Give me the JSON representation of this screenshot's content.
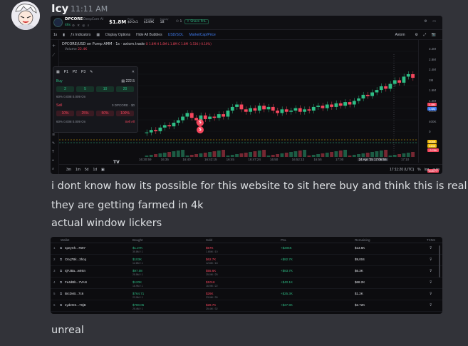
{
  "message": {
    "username": "Icy",
    "timestamp": "11:11 AM",
    "lines": [
      "i dont know how its possible for this website to sit here buy and think this is real",
      "they are getting farmed in 4k",
      "actual window lickers"
    ],
    "followup": "unreal"
  },
  "colors": {
    "background": "#323339",
    "candle_up": "#2ebd85",
    "candle_down": "#f6465d",
    "accent": "#3f7cf0"
  },
  "token": {
    "ticker": "DPCORE",
    "name": "DeepCore AI",
    "age": "46s",
    "market_cap": "$1.8M",
    "stats": [
      {
        "label": "Price",
        "value": "$0.0₃1"
      },
      {
        "label": "Liquidity",
        "value": "$149K"
      },
      {
        "label": "Supply",
        "value": "1B"
      }
    ],
    "holders": "1",
    "share_label": "Share PnL"
  },
  "toolbar": {
    "interval": "1s",
    "indicators": "Indicators",
    "display_options": "Display Options",
    "hide_bubbles": "Hide All Bubbles",
    "pair_toggle": "USD/SOL",
    "mcap_toggle": "MarketCap/Price",
    "right_label": "Axiom"
  },
  "chart": {
    "title": "DPCORE/USD on Pump AMM · 1s · axiom.trade",
    "ohlc": "O 1.8M  H 1.8M  L 1.8M  C 1.8M  -1.53K (-0.10%)",
    "volume_label": "Volume",
    "volume_value": "22.4K",
    "price_ticks": [
      "3.2M",
      "2.8M",
      "2.4M",
      "2M",
      "1.6M",
      "1.2M",
      "800K",
      "400K",
      "0",
      "-400K"
    ],
    "price_tags": [
      {
        "value": "1.8M",
        "color": "#f6465d"
      },
      {
        "value": "1.6M",
        "color": "#3f7cf0"
      },
      {
        "value": "306K",
        "color": "#f0b90b"
      },
      {
        "value": "348K",
        "color": "#f0b90b"
      },
      {
        "value": "-3.25K",
        "color": "#f6465d"
      },
      {
        "value": "308.77",
        "color": "#f6465d"
      }
    ],
    "time_ticks": [
      "16:30:59",
      "16:35",
      "16:40",
      "16:42:15",
      "16:45",
      "16:47:24",
      "16:50",
      "16:52:13",
      "16:55",
      "17:00",
      "24 Apr '25  17:06:56",
      "17:05",
      "17:10"
    ],
    "ranges": [
      "3m",
      "1m",
      "5d",
      "1d"
    ],
    "clock": "17:11:20 (UTC)",
    "scale_options": [
      "%",
      "log",
      "auto"
    ],
    "bubbles": [
      "S",
      "S"
    ],
    "candles": [
      0.12,
      0.14,
      0.13,
      0.16,
      0.18,
      0.17,
      0.2,
      0.22,
      0.25,
      0.28,
      0.24,
      0.22,
      0.26,
      0.23,
      0.25,
      0.24,
      0.27,
      0.25,
      0.3,
      0.33,
      0.35,
      0.31,
      0.29,
      0.32,
      0.3,
      0.34,
      0.31,
      0.33,
      0.3,
      0.28,
      0.31,
      0.29,
      0.3,
      0.32,
      0.29,
      0.31,
      0.3,
      0.33,
      0.34,
      0.32,
      0.35,
      0.33,
      0.36,
      0.34,
      0.37,
      0.35,
      0.38,
      0.4,
      0.43,
      0.42,
      0.45,
      0.47,
      0.5,
      0.48,
      0.52,
      0.55,
      0.53,
      0.58,
      0.6,
      0.57
    ]
  },
  "trade_panel": {
    "presets": [
      "P1",
      "P2",
      "P3"
    ],
    "buy_label": "Buy",
    "balance": "222.5",
    "buy_amounts": [
      "2",
      "5",
      "10",
      "20"
    ],
    "sell_label": "Sell",
    "sell_amounts": [
      "10%",
      "25%",
      "50%",
      "100%"
    ],
    "position": "0 DPCORE · $0",
    "row_buy": "60%   0.008   0.009   On",
    "row_sell": "60%   0.008   0.009   On",
    "sell_all": "Sell All"
  },
  "table": {
    "headers": [
      "Wallet",
      "Bought",
      "Sold",
      "PnL",
      "Remaining",
      "TXNS"
    ],
    "rows": [
      {
        "rank": "1",
        "wallet": "4peyXh...7697",
        "bought": "$1.27K",
        "bought_sub": "35.8M / 1",
        "sold": "$57K",
        "sold_sub": "1.65M / 10",
        "pnl": "+$205K",
        "remaining": "$13.6K"
      },
      {
        "rank": "2",
        "wallet": "CKq7Bk...3hcq",
        "bought": "$103K",
        "bought_sub": "12.8M / 1",
        "sold": "$62.7K",
        "sold_sub": "12.8M / 18",
        "pnl": "+$82.7K",
        "remaining": "$9,004"
      },
      {
        "rank": "3",
        "wallet": "4jFJBa...w9Sn",
        "bought": "$97.08",
        "bought_sub": "25.5M / 1",
        "sold": "$55.6K",
        "sold_sub": "25.0M / 25",
        "pnl": "+$83.7K",
        "remaining": "$6.3K"
      },
      {
        "rank": "4",
        "wallet": "Fe4dBb...7VAN",
        "bought": "$120K",
        "bought_sub": "16.9M / 1",
        "sold": "$101K",
        "sold_sub": "16.9M / 22",
        "pnl": "+$40.1K",
        "remaining": "$68.2K"
      },
      {
        "rank": "5",
        "wallet": "BrcDvB...7c6",
        "bought": "$764.71",
        "bought_sub": "23.9M / 1",
        "sold": "$26K",
        "sold_sub": "23.9M / 30",
        "pnl": "+$25.3K",
        "remaining": "$1.2K"
      },
      {
        "rank": "6",
        "wallet": "4yd2GS...7SjB",
        "bought": "$780.05",
        "bought_sub": "25.4M / 1",
        "sold": "$28.7K",
        "sold_sub": "25.4M / 32",
        "pnl": "+$27.9K",
        "remaining": "$2.72K"
      }
    ]
  }
}
